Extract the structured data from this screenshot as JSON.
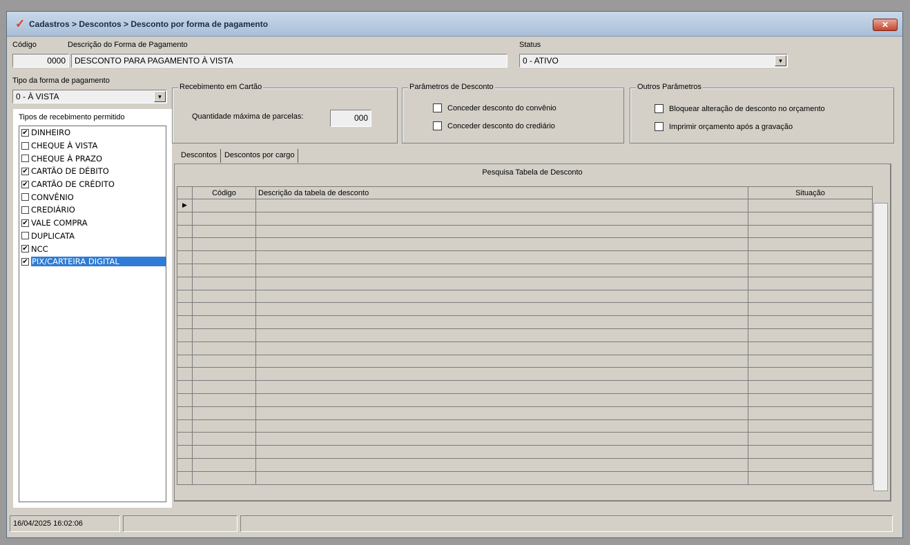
{
  "window": {
    "title": "Cadastros > Descontos > Desconto por forma de pagamento",
    "close_label": "✕"
  },
  "header": {
    "codigo_label": "Código",
    "codigo_value": "0000",
    "descricao_label": "Descrição do Forma de Pagamento",
    "descricao_value": "DESCONTO PARA PAGAMENTO À VISTA",
    "status_label": "Status",
    "status_value": "0 - ATIVO"
  },
  "tipo": {
    "label": "Tipo da forma de pagamento",
    "value": "0 - À VISTA"
  },
  "recebimento_cartao": {
    "title": "Recebimento em Cartão",
    "label": "Quantidade máxima de parcelas:",
    "value": "000"
  },
  "parametros_desconto": {
    "title": "Parâmetros de Desconto",
    "items": [
      {
        "label": "Conceder desconto do convênio",
        "checked": false
      },
      {
        "label": "Conceder desconto do crediário",
        "checked": false
      }
    ]
  },
  "outros_parametros": {
    "title": "Outros Parâmetros",
    "items": [
      {
        "label": "Bloquear alteração de desconto no orçamento",
        "checked": false
      },
      {
        "label": "Imprimir orçamento após a gravação",
        "checked": false
      }
    ]
  },
  "tipos_recebimento": {
    "label": "Tipos de recebimento permitido",
    "items": [
      {
        "label": "DINHEIRO",
        "checked": true
      },
      {
        "label": "CHEQUE À VISTA",
        "checked": false
      },
      {
        "label": "CHEQUE À PRAZO",
        "checked": false
      },
      {
        "label": "CARTÃO DE DÉBITO",
        "checked": true
      },
      {
        "label": "CARTÃO DE CRÉDITO",
        "checked": true
      },
      {
        "label": "CONVÊNIO",
        "checked": false
      },
      {
        "label": "CREDIÁRIO",
        "checked": false
      },
      {
        "label": "VALE COMPRA",
        "checked": true
      },
      {
        "label": "DUPLICATA",
        "checked": false
      },
      {
        "label": "NCC",
        "checked": true
      },
      {
        "label": "PIX/CARTEIRA DIGITAL",
        "checked": true,
        "selected": true
      }
    ]
  },
  "tabs": [
    "Descontos",
    "Descontos por cargo"
  ],
  "grid": {
    "title": "Pesquisa Tabela de Desconto",
    "columns": [
      "Código",
      "Descrição da tabela de desconto",
      "Situação"
    ],
    "rows": [],
    "current_row_marker": "▶"
  },
  "statusbar": {
    "datetime": "16/04/2025 16:02:06",
    "cell2": "",
    "cell3": ""
  },
  "colors": {
    "selection": "#2f7bd6",
    "logo": "#e0411b"
  }
}
